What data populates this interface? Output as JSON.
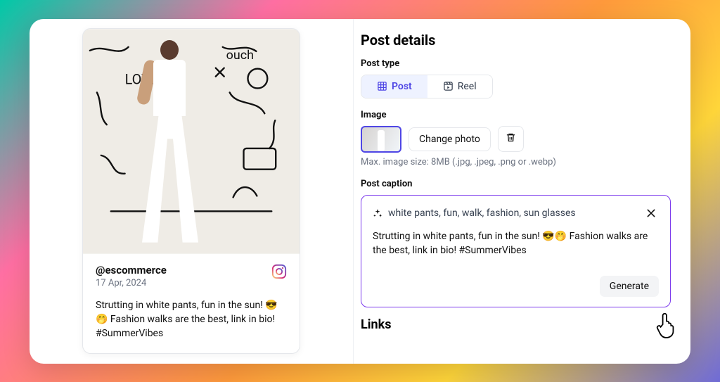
{
  "preview": {
    "handle": "@escommerce",
    "date": "17 Apr, 2024",
    "caption": "Strutting in white pants, fun in the sun! 😎🤭 Fashion walks are the best, link in bio! #SummerVibes"
  },
  "details": {
    "title": "Post details",
    "post_type_label": "Post type",
    "post_type": {
      "post": "Post",
      "reel": "Reel"
    },
    "image_label": "Image",
    "change_photo": "Change photo",
    "image_hint": "Max. image size: 8MB (.jpg, .jpeg, .png or .webp)",
    "caption_label": "Post caption",
    "prompt_keywords": "white pants, fun, walk, fashion, sun glasses",
    "generated_caption": "Strutting in white pants, fun in the sun! 😎🤭 Fashion walks are the best, link in bio! #SummerVibes",
    "generate_btn": "Generate",
    "links_title": "Links"
  }
}
